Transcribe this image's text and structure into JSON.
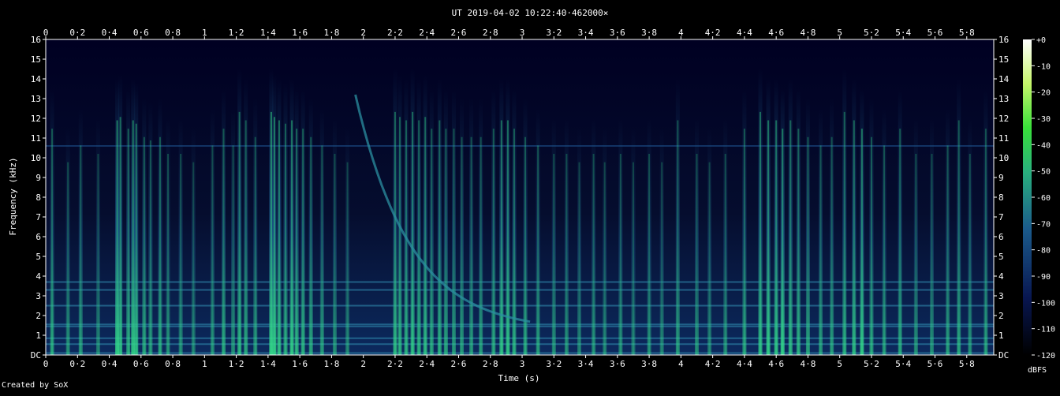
{
  "chart_data": {
    "type": "heatmap",
    "title": "UT 2019-04-02 10:22:40·462000×",
    "xlabel": "Time (s)",
    "ylabel": "Frequency (kHz)",
    "xlim": [
      0,
      5.97
    ],
    "ylim": [
      0,
      16
    ],
    "x_ticks": [
      "0",
      "0·2",
      "0·4",
      "0·6",
      "0·8",
      "1",
      "1·2",
      "1·4",
      "1·6",
      "1·8",
      "2",
      "2·2",
      "2·4",
      "2·6",
      "2·8",
      "3",
      "3·2",
      "3·4",
      "3·6",
      "3·8",
      "4",
      "4·2",
      "4·4",
      "4·6",
      "4·8",
      "5",
      "5·2",
      "5·4",
      "5·6",
      "5·8"
    ],
    "x_tick_values": [
      0,
      0.2,
      0.4,
      0.6,
      0.8,
      1.0,
      1.2,
      1.4,
      1.6,
      1.8,
      2.0,
      2.2,
      2.4,
      2.6,
      2.8,
      3.0,
      3.2,
      3.4,
      3.6,
      3.8,
      4.0,
      4.2,
      4.4,
      4.6,
      4.8,
      5.0,
      5.2,
      5.4,
      5.6,
      5.8
    ],
    "y_ticks": [
      "DC",
      "1",
      "2",
      "3",
      "4",
      "5",
      "6",
      "7",
      "8",
      "9",
      "10",
      "11",
      "12",
      "13",
      "14",
      "15",
      "16"
    ],
    "y_tick_values": [
      0,
      1,
      2,
      3,
      4,
      5,
      6,
      7,
      8,
      9,
      10,
      11,
      12,
      13,
      14,
      15,
      16
    ],
    "colorbar": {
      "label": "dBFS",
      "range": [
        -120,
        0
      ],
      "ticks": [
        "+0",
        "-10",
        "-20",
        "-30",
        "-40",
        "-50",
        "-60",
        "-70",
        "-80",
        "-90",
        "-100",
        "-110",
        "-120"
      ],
      "tick_values": [
        0,
        -10,
        -20,
        -30,
        -40,
        -50,
        -60,
        -70,
        -80,
        -90,
        -100,
        -110,
        -120
      ]
    },
    "colors": {
      "background": "#000000",
      "plot_background": "#050d2e",
      "low": "#000022",
      "mid": "#1d5f8f",
      "high": "#35e08a",
      "max": "#ffffff"
    },
    "broadband_events": [
      {
        "t": 0.04,
        "top": 13.5,
        "level": 0.55
      },
      {
        "t": 0.14,
        "top": 11.5,
        "level": 0.45
      },
      {
        "t": 0.22,
        "top": 12.5,
        "level": 0.5
      },
      {
        "t": 0.33,
        "top": 12.0,
        "level": 0.4
      },
      {
        "t": 0.45,
        "top": 14.0,
        "level": 0.8
      },
      {
        "t": 0.47,
        "top": 14.2,
        "level": 0.7
      },
      {
        "t": 0.52,
        "top": 13.5,
        "level": 0.6
      },
      {
        "t": 0.55,
        "top": 14.0,
        "level": 0.75
      },
      {
        "t": 0.57,
        "top": 13.8,
        "level": 0.7
      },
      {
        "t": 0.62,
        "top": 13.0,
        "level": 0.55
      },
      {
        "t": 0.66,
        "top": 12.8,
        "level": 0.5
      },
      {
        "t": 0.72,
        "top": 13.0,
        "level": 0.55
      },
      {
        "t": 0.77,
        "top": 12.0,
        "level": 0.45
      },
      {
        "t": 0.85,
        "top": 12.0,
        "level": 0.45
      },
      {
        "t": 0.93,
        "top": 11.5,
        "level": 0.4
      },
      {
        "t": 1.05,
        "top": 12.5,
        "level": 0.45
      },
      {
        "t": 1.12,
        "top": 13.5,
        "level": 0.55
      },
      {
        "t": 1.18,
        "top": 12.5,
        "level": 0.45
      },
      {
        "t": 1.22,
        "top": 14.5,
        "level": 0.65
      },
      {
        "t": 1.26,
        "top": 14.0,
        "level": 0.55
      },
      {
        "t": 1.32,
        "top": 13.0,
        "level": 0.5
      },
      {
        "t": 1.42,
        "top": 14.5,
        "level": 0.85
      },
      {
        "t": 1.44,
        "top": 14.2,
        "level": 0.8
      },
      {
        "t": 1.47,
        "top": 14.0,
        "level": 0.7
      },
      {
        "t": 1.51,
        "top": 13.8,
        "level": 0.6
      },
      {
        "t": 1.55,
        "top": 14.0,
        "level": 0.75
      },
      {
        "t": 1.58,
        "top": 13.5,
        "level": 0.65
      },
      {
        "t": 1.62,
        "top": 13.5,
        "level": 0.6
      },
      {
        "t": 1.67,
        "top": 13.0,
        "level": 0.55
      },
      {
        "t": 1.74,
        "top": 12.5,
        "level": 0.5
      },
      {
        "t": 1.82,
        "top": 12.0,
        "level": 0.45
      },
      {
        "t": 1.9,
        "top": 11.5,
        "level": 0.4
      },
      {
        "t": 2.2,
        "top": 14.5,
        "level": 0.65
      },
      {
        "t": 2.23,
        "top": 14.2,
        "level": 0.6
      },
      {
        "t": 2.27,
        "top": 14.0,
        "level": 0.6
      },
      {
        "t": 2.31,
        "top": 14.5,
        "level": 0.7
      },
      {
        "t": 2.35,
        "top": 14.0,
        "level": 0.6
      },
      {
        "t": 2.39,
        "top": 14.2,
        "level": 0.65
      },
      {
        "t": 2.43,
        "top": 13.5,
        "level": 0.55
      },
      {
        "t": 2.48,
        "top": 14.0,
        "level": 0.6
      },
      {
        "t": 2.52,
        "top": 13.5,
        "level": 0.55
      },
      {
        "t": 2.57,
        "top": 13.5,
        "level": 0.5
      },
      {
        "t": 2.62,
        "top": 13.0,
        "level": 0.5
      },
      {
        "t": 2.68,
        "top": 13.0,
        "level": 0.5
      },
      {
        "t": 2.74,
        "top": 13.0,
        "level": 0.5
      },
      {
        "t": 2.82,
        "top": 13.5,
        "level": 0.55
      },
      {
        "t": 2.87,
        "top": 14.0,
        "level": 0.7
      },
      {
        "t": 2.91,
        "top": 14.0,
        "level": 0.7
      },
      {
        "t": 2.95,
        "top": 13.5,
        "level": 0.6
      },
      {
        "t": 3.02,
        "top": 13.0,
        "level": 0.55
      },
      {
        "t": 3.1,
        "top": 12.5,
        "level": 0.5
      },
      {
        "t": 3.2,
        "top": 12.0,
        "level": 0.45
      },
      {
        "t": 3.28,
        "top": 12.0,
        "level": 0.45
      },
      {
        "t": 3.36,
        "top": 11.5,
        "level": 0.4
      },
      {
        "t": 3.45,
        "top": 12.0,
        "level": 0.45
      },
      {
        "t": 3.52,
        "top": 11.5,
        "level": 0.4
      },
      {
        "t": 3.62,
        "top": 12.0,
        "level": 0.45
      },
      {
        "t": 3.7,
        "top": 11.5,
        "level": 0.4
      },
      {
        "t": 3.8,
        "top": 12.0,
        "level": 0.45
      },
      {
        "t": 3.88,
        "top": 11.5,
        "level": 0.4
      },
      {
        "t": 3.98,
        "top": 14.0,
        "level": 0.5
      },
      {
        "t": 4.1,
        "top": 12.0,
        "level": 0.45
      },
      {
        "t": 4.18,
        "top": 11.5,
        "level": 0.4
      },
      {
        "t": 4.28,
        "top": 12.0,
        "level": 0.45
      },
      {
        "t": 4.4,
        "top": 13.5,
        "level": 0.55
      },
      {
        "t": 4.5,
        "top": 14.5,
        "level": 0.7
      },
      {
        "t": 4.55,
        "top": 14.0,
        "level": 0.75
      },
      {
        "t": 4.6,
        "top": 14.0,
        "level": 0.7
      },
      {
        "t": 4.64,
        "top": 13.5,
        "level": 0.8
      },
      {
        "t": 4.69,
        "top": 14.0,
        "level": 0.65
      },
      {
        "t": 4.74,
        "top": 13.5,
        "level": 0.6
      },
      {
        "t": 4.8,
        "top": 13.0,
        "level": 0.55
      },
      {
        "t": 4.88,
        "top": 12.5,
        "level": 0.5
      },
      {
        "t": 4.95,
        "top": 13.0,
        "level": 0.5
      },
      {
        "t": 5.03,
        "top": 14.5,
        "level": 0.6
      },
      {
        "t": 5.09,
        "top": 14.0,
        "level": 0.65
      },
      {
        "t": 5.14,
        "top": 13.5,
        "level": 0.75
      },
      {
        "t": 5.2,
        "top": 13.0,
        "level": 0.55
      },
      {
        "t": 5.28,
        "top": 12.5,
        "level": 0.5
      },
      {
        "t": 5.38,
        "top": 13.5,
        "level": 0.55
      },
      {
        "t": 5.48,
        "top": 12.0,
        "level": 0.45
      },
      {
        "t": 5.58,
        "top": 12.0,
        "level": 0.45
      },
      {
        "t": 5.68,
        "top": 12.5,
        "level": 0.5
      },
      {
        "t": 5.75,
        "top": 14.0,
        "level": 0.55
      },
      {
        "t": 5.82,
        "top": 12.0,
        "level": 0.45
      },
      {
        "t": 5.92,
        "top": 13.5,
        "level": 0.5
      }
    ],
    "sweep": {
      "t_start": 1.95,
      "f_start": 13.2,
      "t_end": 3.05,
      "f_end": 1.2
    },
    "tone_lines_khz": [
      0.1,
      0.55,
      0.85,
      1.45,
      1.55,
      2.5,
      3.3,
      3.7,
      10.6
    ]
  },
  "footer": {
    "credit": "Created by SoX"
  }
}
